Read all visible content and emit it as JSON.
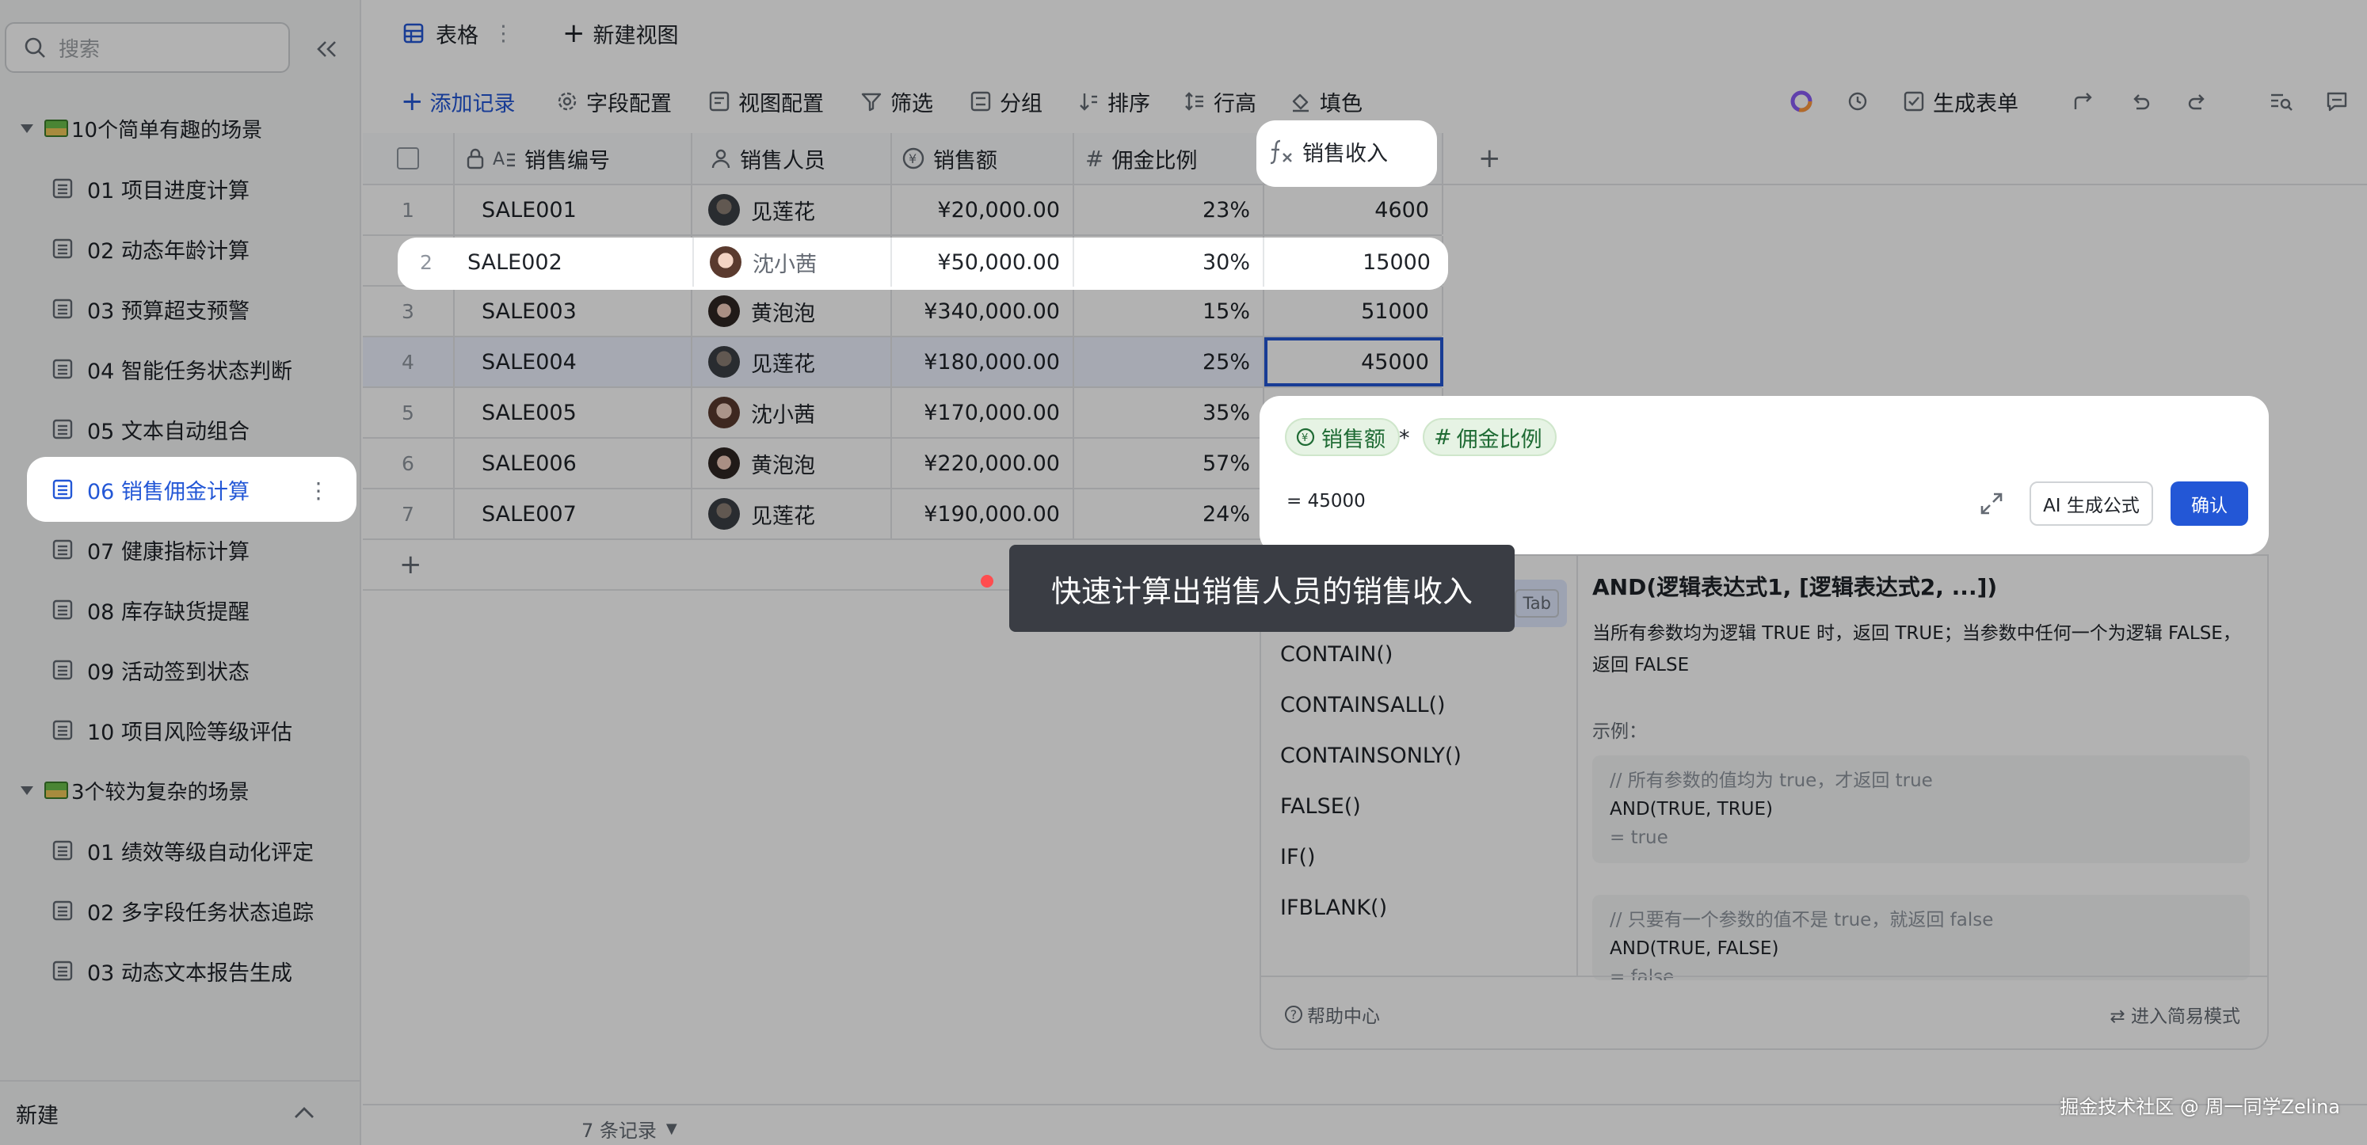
{
  "sidebar": {
    "search_placeholder": "搜索",
    "groups": [
      {
        "label": "10个简单有趣的场景",
        "items": [
          "01 项目进度计算",
          "02 动态年龄计算",
          "03 预算超支预警",
          "04 智能任务状态判断",
          "05 文本自动组合",
          "06 销售佣金计算",
          "07 健康指标计算",
          "08 库存缺货提醒",
          "09 活动签到状态",
          "10 项目风险等级评估"
        ]
      },
      {
        "label": "3个较为复杂的场景",
        "items": [
          "01 绩效等级自动化评定",
          "02 多字段任务状态追踪",
          "03 动态文本报告生成"
        ]
      }
    ],
    "active_item": "06 销售佣金计算",
    "footer_label": "新建"
  },
  "view_tabs": {
    "current": "表格",
    "new_view": "新建视图"
  },
  "toolbar": {
    "add_record": "添加记录",
    "field_config": "字段配置",
    "view_config": "视图配置",
    "filter": "筛选",
    "group": "分组",
    "sort": "排序",
    "row_height": "行高",
    "fill_color": "填色",
    "generate_form": "生成表单"
  },
  "table": {
    "columns": [
      "销售编号",
      "销售人员",
      "销售额",
      "佣金比例",
      "销售收入"
    ],
    "rows": [
      {
        "n": "1",
        "id": "SALE001",
        "person": "见莲花",
        "amount": "¥20,000.00",
        "rate": "23%",
        "income": "4600"
      },
      {
        "n": "2",
        "id": "SALE002",
        "person": "沈小茜",
        "amount": "¥50,000.00",
        "rate": "30%",
        "income": "15000"
      },
      {
        "n": "3",
        "id": "SALE003",
        "person": "黄泡泡",
        "amount": "¥340,000.00",
        "rate": "15%",
        "income": "51000"
      },
      {
        "n": "4",
        "id": "SALE004",
        "person": "见莲花",
        "amount": "¥180,000.00",
        "rate": "25%",
        "income": "45000"
      },
      {
        "n": "5",
        "id": "SALE005",
        "person": "沈小茜",
        "amount": "¥170,000.00",
        "rate": "35%",
        "income": ""
      },
      {
        "n": "6",
        "id": "SALE006",
        "person": "黄泡泡",
        "amount": "¥220,000.00",
        "rate": "57%",
        "income": ""
      },
      {
        "n": "7",
        "id": "SALE007",
        "person": "见莲花",
        "amount": "¥190,000.00",
        "rate": "24%",
        "income": ""
      }
    ],
    "record_count": "7 条记录"
  },
  "formula": {
    "token1": "销售额",
    "operator": "*",
    "token2": "佣金比例",
    "result": "= 45000",
    "ai_button": "AI 生成公式",
    "confirm_button": "确认"
  },
  "functions": {
    "list": [
      "AND()",
      "CONTAIN()",
      "CONTAINSALL()",
      "CONTAINSONLY()",
      "FALSE()",
      "IF()",
      "IFBLANK()"
    ],
    "tab_hint": "Tab",
    "signature": "AND(逻辑表达式1, [逻辑表达式2, ...])",
    "description": "当所有参数均为逻辑 TRUE 时，返回 TRUE；当参数中任何一个为逻辑 FALSE，返回 FALSE",
    "example_title": "示例：",
    "example1": {
      "comment": "// 所有参数的值均为 true，才返回 true",
      "code": "AND(TRUE, TRUE)",
      "result": "= true"
    },
    "example2": {
      "comment": "// 只要有一个参数的值不是 true，就返回 false",
      "code": "AND(TRUE, FALSE)",
      "result": "= false"
    },
    "help": "帮助中心",
    "simple_mode": "进入简易模式"
  },
  "tooltip": "快速计算出销售人员的销售收入",
  "watermark": "掘金技术社区 @ 周一同学Zelina",
  "colors": {
    "accent": "#2357d6",
    "token_bg": "#e6f3e4",
    "tooltip_bg": "#3a3d44"
  }
}
